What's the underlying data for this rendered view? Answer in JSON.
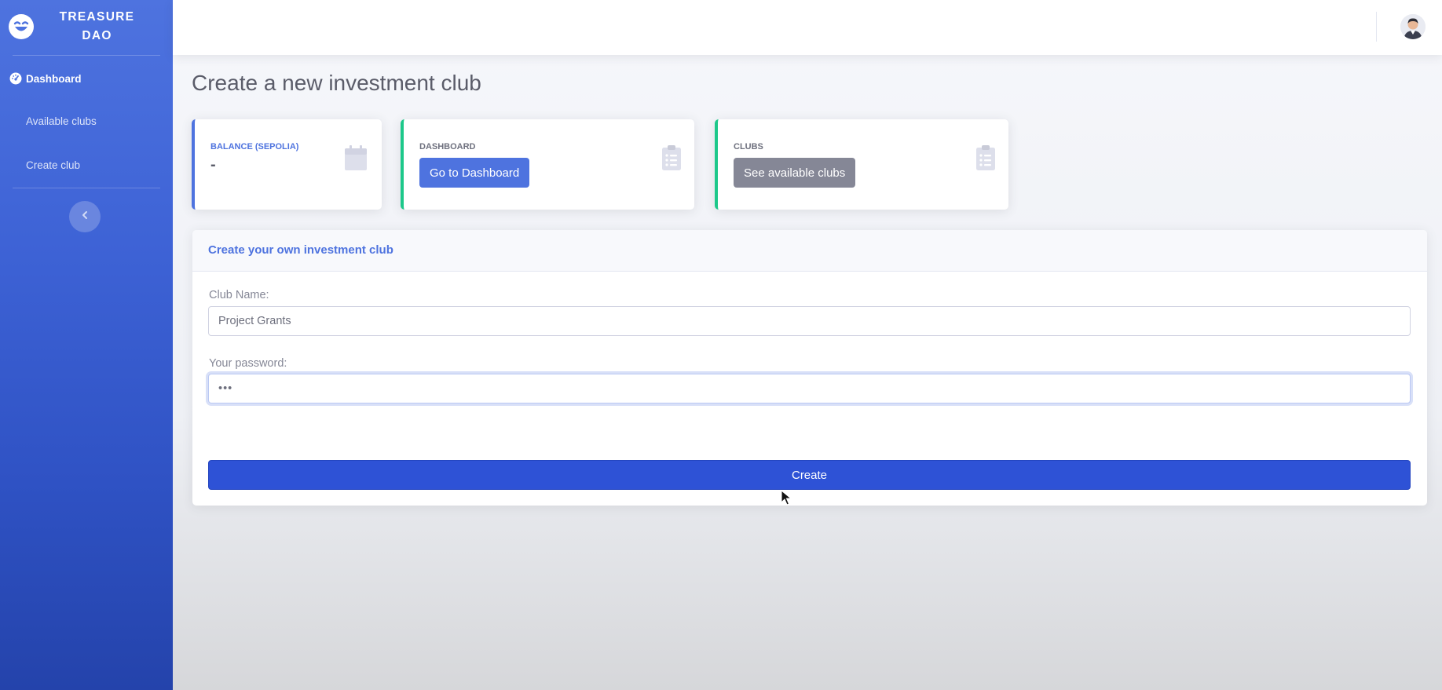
{
  "sidebar": {
    "brand": "TREASURE DAO",
    "brand_icon": "smiley-logo-icon",
    "items": [
      {
        "label": "Dashboard",
        "icon": "tachometer-icon",
        "active": true
      },
      {
        "label": "Available clubs"
      },
      {
        "label": "Create club"
      }
    ],
    "toggle_icon": "chevron-left-icon"
  },
  "topbar": {
    "avatar_icon": "user-avatar-icon"
  },
  "page": {
    "title": "Create a new investment club"
  },
  "cards": [
    {
      "label": "BALANCE (SEPOLIA)",
      "value": "-",
      "icon": "calendar-icon",
      "accent": "#4e73df"
    },
    {
      "label": "DASHBOARD",
      "button": "Go to Dashboard",
      "icon": "clipboard-list-icon",
      "accent": "#1cc88a",
      "button_color": "#4e73df"
    },
    {
      "label": "CLUBS",
      "button": "See available clubs",
      "icon": "clipboard-list-icon",
      "accent": "#1cc88a",
      "button_color": "#858796"
    }
  ],
  "form": {
    "header": "Create your own investment club",
    "club_name": {
      "label": "Club Name:",
      "value": "Project Grants"
    },
    "password": {
      "label": "Your password:",
      "value": "•••"
    },
    "submit": "Create"
  },
  "colors": {
    "primary": "#4e73df",
    "success": "#1cc88a",
    "secondary": "#858796",
    "create_button": "#2e52d6"
  }
}
